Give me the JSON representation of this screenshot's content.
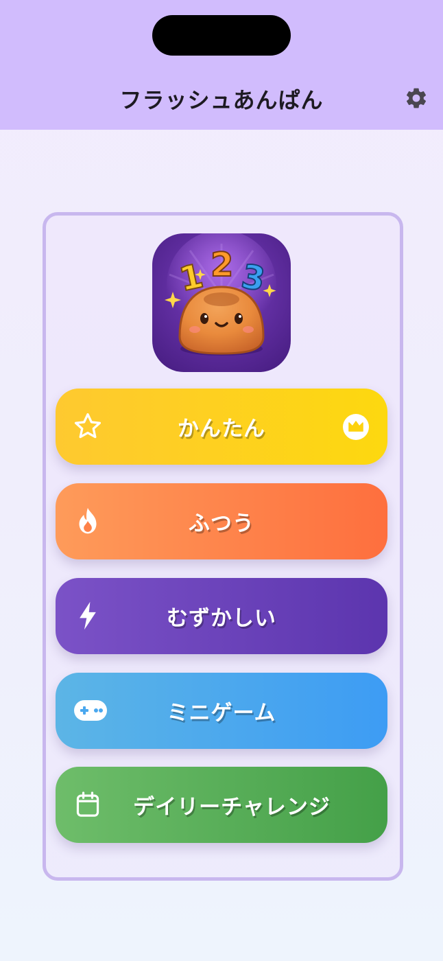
{
  "app": {
    "title": "フラッシュあんぱん"
  },
  "header": {
    "settings_icon": "gear-icon"
  },
  "logo": {
    "digits": [
      "1",
      "2",
      "3"
    ]
  },
  "menu": [
    {
      "id": "easy",
      "label": "かんたん",
      "icon": "star-icon",
      "badge_icon": "crown-icon",
      "color": "#fdd20f"
    },
    {
      "id": "normal",
      "label": "ふつう",
      "icon": "flame-icon",
      "color": "#fe8249"
    },
    {
      "id": "hard",
      "label": "むずかしい",
      "icon": "lightning-icon",
      "color": "#6a42b9"
    },
    {
      "id": "minigame",
      "label": "ミニゲーム",
      "icon": "gamepad-icon",
      "color": "#4aa8ef"
    },
    {
      "id": "daily",
      "label": "デイリーチャレンジ",
      "icon": "calendar-icon",
      "color": "#55ab56"
    }
  ],
  "colors": {
    "header_bg": "#d1bcfd",
    "card_border": "#c8b7ee"
  }
}
